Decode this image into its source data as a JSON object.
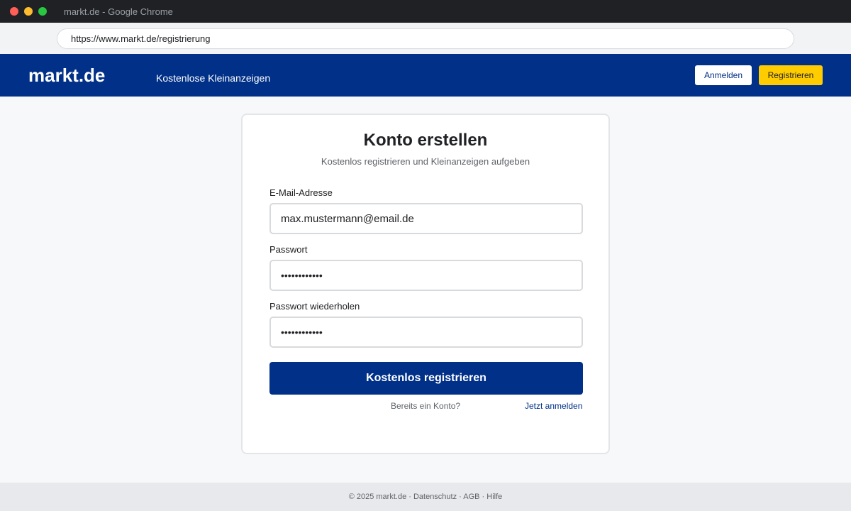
{
  "window": {
    "title": "markt.de - Google Chrome"
  },
  "browser": {
    "url": "https://www.markt.de/registrierung"
  },
  "header": {
    "logo": "markt.de",
    "tagline": "Kostenlose Kleinanzeigen",
    "login_label": "Anmelden",
    "register_label": "Registrieren"
  },
  "form": {
    "title": "Konto erstellen",
    "subtitle": "Kostenlos registrieren und Kleinanzeigen aufgeben",
    "email_label": "E-Mail-Adresse",
    "email_value": "max.mustermann@email.de",
    "password_label": "Passwort",
    "password_value": "••••••••••••",
    "password_repeat_label": "Passwort wiederholen",
    "password_repeat_value": "••••••••••••",
    "submit_label": "Kostenlos registrieren",
    "existing_account_text": "Bereits ein Konto?",
    "login_link_label": "Jetzt anmelden"
  },
  "footer": {
    "text": "© 2025 markt.de · Datenschutz · AGB · Hilfe"
  },
  "colors": {
    "brand_blue": "#003087",
    "brand_yellow": "#ffcc00"
  }
}
